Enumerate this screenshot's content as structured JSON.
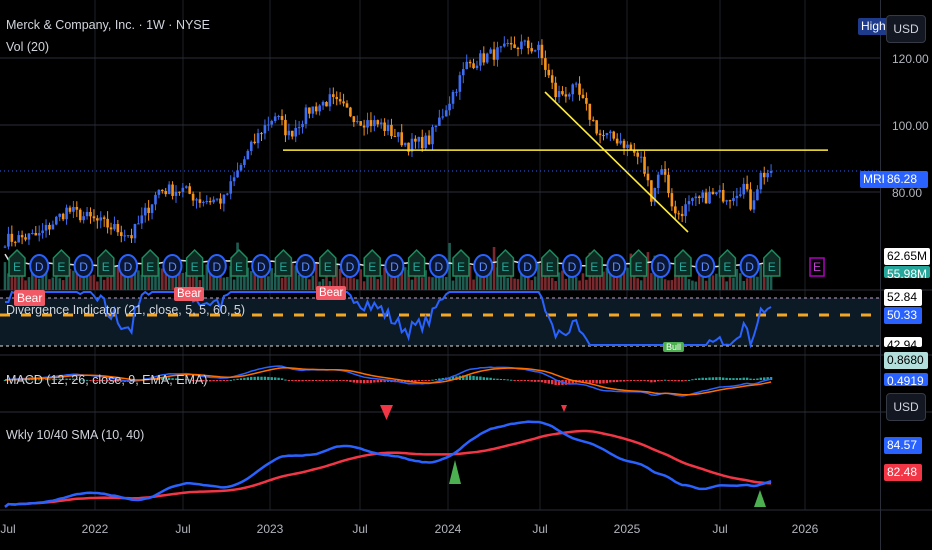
{
  "header": {
    "title": "Merck & Company, Inc. · 1W · NYSE",
    "vol_label": "Vol (20)"
  },
  "indicators": {
    "divergence": "Divergence Indicator (21, close, 5, 5, 60, 5)",
    "macd": "MACD (12, 26, close, 9, EMA, EMA)",
    "sma": "Wkly 10/40 SMA (10, 40)"
  },
  "signals": {
    "bear": "Bear",
    "bull": "Bull"
  },
  "price_axis": {
    "ticks": [
      "120.00",
      "100.00",
      "80.00"
    ],
    "high_label": "High",
    "currency": "USD",
    "symbol": "MRK",
    "last_price": "86.28"
  },
  "volume_axis": {
    "volume": "62.65M",
    "volume_ma": "55.98M"
  },
  "divergence_axis": {
    "upper": "52.84",
    "value": "50.33",
    "lower": "42.94"
  },
  "macd_axis": {
    "macd": "0.8680",
    "signal": "0.4919"
  },
  "sma_axis": {
    "currency": "USD",
    "fast": "84.57",
    "slow": "82.48"
  },
  "earnings": {
    "earnings_letter": "E",
    "dividend_letter": "D"
  },
  "time_axis": [
    "Jul",
    "2022",
    "Jul",
    "2023",
    "Jul",
    "2024",
    "Jul",
    "2025",
    "Jul",
    "2026"
  ],
  "colors": {
    "up": "#3d6df2",
    "down": "#f7931a",
    "accent": "#2962ff",
    "bear": "#f23645",
    "bull": "#4caf50",
    "trendline": "#ffeb3b",
    "sma_fast": "#2962ff",
    "sma_slow": "#f23645"
  },
  "chart_data": {
    "type": "candlestick",
    "interval": "1W",
    "first_week": "Jul 2021",
    "close_keypoints": [
      [
        0,
        65.7
      ],
      [
        10,
        67
      ],
      [
        18,
        74.6
      ],
      [
        26,
        71.6
      ],
      [
        37,
        67
      ],
      [
        45,
        80.6
      ],
      [
        52,
        80.6
      ],
      [
        57,
        77.6
      ],
      [
        64,
        77.6
      ],
      [
        69,
        88
      ],
      [
        75,
        98.5
      ],
      [
        79,
        103
      ],
      [
        83,
        97
      ],
      [
        89,
        104.5
      ],
      [
        95,
        107.5
      ],
      [
        104,
        101.5
      ],
      [
        110,
        100
      ],
      [
        118,
        94
      ],
      [
        124,
        95.5
      ],
      [
        130,
        107.5
      ],
      [
        135,
        118
      ],
      [
        142,
        121
      ],
      [
        151,
        124
      ],
      [
        156,
        122.4
      ],
      [
        161,
        109
      ],
      [
        167,
        110.4
      ],
      [
        174,
        97
      ],
      [
        180,
        95.5
      ],
      [
        186,
        89.5
      ],
      [
        189,
        79
      ],
      [
        192,
        88
      ],
      [
        196,
        73
      ],
      [
        200,
        76
      ],
      [
        206,
        79
      ],
      [
        212,
        79
      ],
      [
        216,
        82
      ],
      [
        218,
        76
      ],
      [
        221,
        85
      ],
      [
        224,
        86.28
      ]
    ],
    "horizontal_line": 92.5,
    "price_range": [
      60,
      130
    ]
  }
}
